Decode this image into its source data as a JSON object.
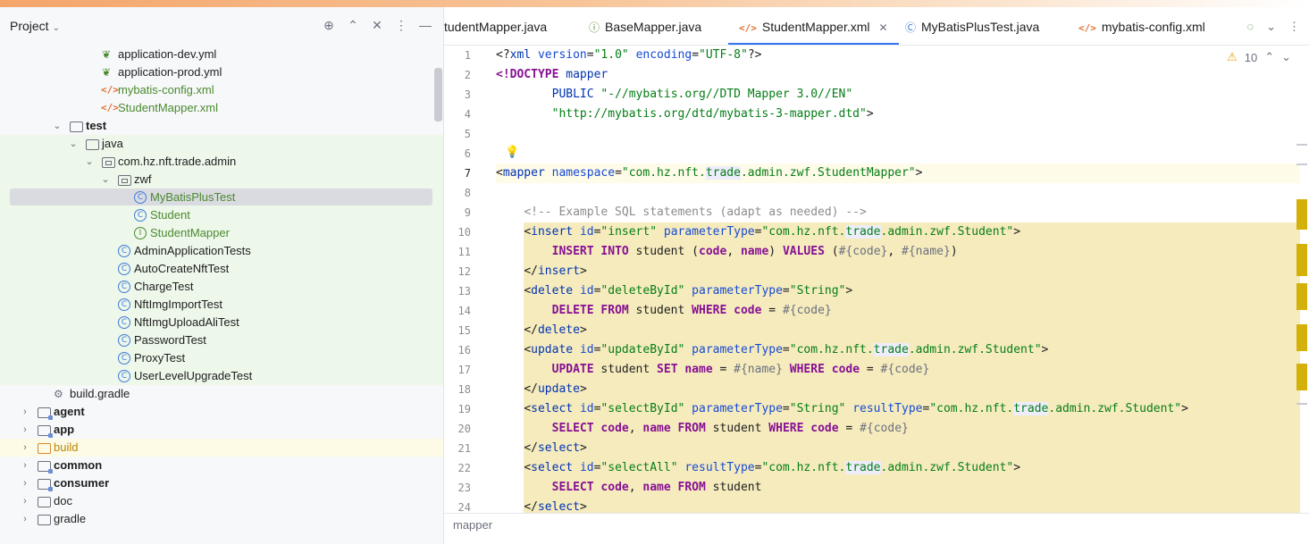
{
  "project_panel": {
    "title": "Project",
    "title_chevron": "⌄",
    "tools": [
      "⊕",
      "⌃",
      "✕",
      "⋮",
      "—"
    ],
    "tree": [
      {
        "label": "application-dev.yml",
        "icon": "leaf-icon"
      },
      {
        "label": "application-prod.yml",
        "icon": "leaf-icon"
      },
      {
        "label": "mybatis-config.xml",
        "icon": "xml-icon"
      },
      {
        "label": "StudentMapper.xml",
        "icon": "xml-icon"
      },
      {
        "label": "test",
        "icon": "folder-icon"
      },
      {
        "label": "java",
        "icon": "folder-icon"
      },
      {
        "label": "com.hz.nft.trade.admin",
        "icon": "package-icon"
      },
      {
        "label": "zwf",
        "icon": "package-icon"
      },
      {
        "label": "MyBatisPlusTest",
        "icon": "class-icon"
      },
      {
        "label": "Student",
        "icon": "class-icon"
      },
      {
        "label": "StudentMapper",
        "icon": "interface-icon"
      },
      {
        "label": "AdminApplicationTests",
        "icon": "class-icon"
      },
      {
        "label": "AutoCreateNftTest",
        "icon": "class-icon"
      },
      {
        "label": "ChargeTest",
        "icon": "class-icon"
      },
      {
        "label": "NftImgImportTest",
        "icon": "class-icon"
      },
      {
        "label": "NftImgUploadAliTest",
        "icon": "class-icon"
      },
      {
        "label": "PasswordTest",
        "icon": "class-icon"
      },
      {
        "label": "ProxyTest",
        "icon": "class-icon"
      },
      {
        "label": "UserLevelUpgradeTest",
        "icon": "class-icon"
      },
      {
        "label": "build.gradle",
        "icon": "gradle-icon"
      },
      {
        "label": "agent",
        "icon": "module-folder-icon"
      },
      {
        "label": "app",
        "icon": "module-folder-icon"
      },
      {
        "label": "build",
        "icon": "folder-icon"
      },
      {
        "label": "common",
        "icon": "module-folder-icon"
      },
      {
        "label": "consumer",
        "icon": "module-folder-icon"
      },
      {
        "label": "doc",
        "icon": "folder-icon"
      },
      {
        "label": "gradle",
        "icon": "folder-icon"
      }
    ]
  },
  "editor": {
    "tabs": [
      {
        "label": "tudentMapper.java",
        "icon": "interface-icon"
      },
      {
        "label": "BaseMapper.java",
        "icon": "interface-icon"
      },
      {
        "label": "StudentMapper.xml",
        "icon": "xml-icon",
        "active": true,
        "close": "✕"
      },
      {
        "label": "MyBatisPlusTest.java",
        "icon": "class-icon"
      },
      {
        "label": "mybatis-config.xml",
        "icon": "xml-icon"
      }
    ],
    "tab_tools": [
      "⌄",
      "⋮"
    ],
    "warnings": {
      "count": "10",
      "up": "⌃",
      "down": "⌄"
    },
    "lines": [
      "1",
      "2",
      "3",
      "4",
      "5",
      "6",
      "7",
      "8",
      "9",
      "10",
      "11",
      "12",
      "13",
      "14",
      "15",
      "16",
      "17",
      "18",
      "19",
      "20",
      "21",
      "22",
      "23",
      "24"
    ],
    "breadcrumb": "mapper"
  },
  "colors": {
    "accent": "#3574f0",
    "highlight": "#f5ebbd",
    "tree_green": "#edf7ea"
  }
}
